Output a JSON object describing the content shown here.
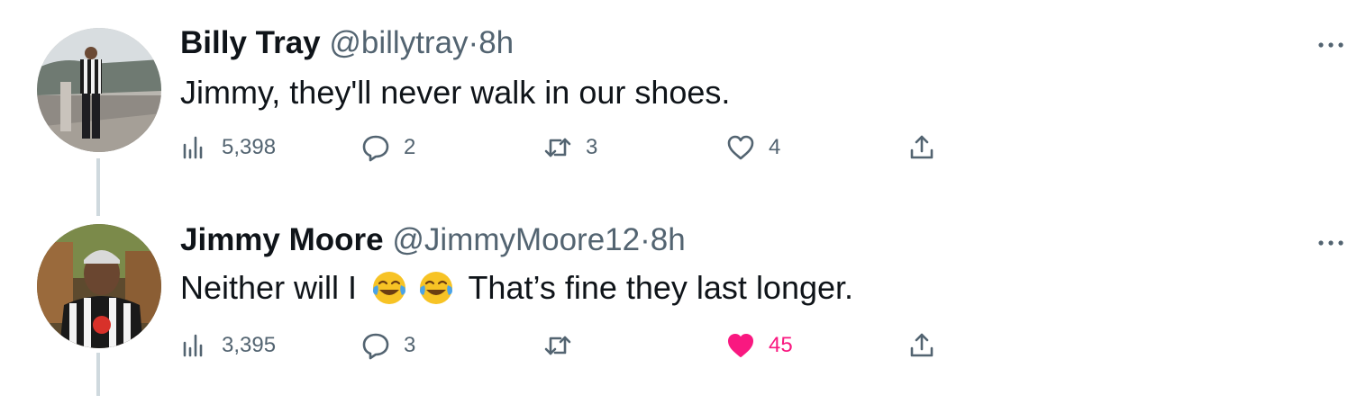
{
  "tweets": [
    {
      "author_name": "Billy Tray",
      "handle": "@billytray",
      "separator": "·",
      "time": "8h",
      "text": "Jimmy, they'll never walk in our shoes.",
      "views": "5,398",
      "replies": "2",
      "retweets": "3",
      "likes": "4",
      "liked": false
    },
    {
      "author_name": "Jimmy Moore",
      "handle": "@JimmyMoore12",
      "separator": "·",
      "time": "8h",
      "text_before": "Neither will I",
      "text_after": "That’s fine they last longer.",
      "emoji": "face-with-tears-of-joy",
      "views": "3,395",
      "replies": "3",
      "retweets": "",
      "likes": "45",
      "liked": true
    }
  ],
  "colors": {
    "text_primary": "#0f1419",
    "text_secondary": "#536471",
    "like_active": "#f91880",
    "thread_line": "#cfd9de"
  },
  "icons": [
    "views-icon",
    "reply-icon",
    "retweet-icon",
    "like-icon",
    "share-icon",
    "more-icon"
  ]
}
